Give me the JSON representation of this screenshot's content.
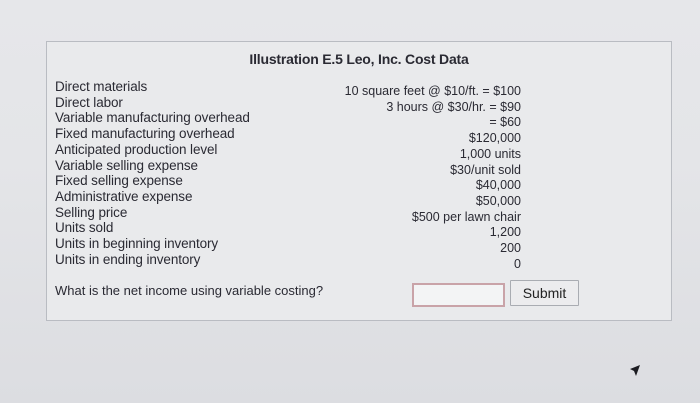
{
  "title": "Illustration E.5 Leo, Inc. Cost Data",
  "cost_data": [
    {
      "label": "Direct materials",
      "value": "10 square feet @ $10/ft. = $100"
    },
    {
      "label": "Direct labor",
      "value": "3 hours @ $30/hr. = $90"
    },
    {
      "label": "Variable manufacturing overhead",
      "value": "= $60"
    },
    {
      "label": "Fixed manufacturing overhead",
      "value": "$120,000"
    },
    {
      "label": "Anticipated production level",
      "value": "1,000 units"
    },
    {
      "label": "Variable selling expense",
      "value": "$30/unit sold"
    },
    {
      "label": "Fixed selling expense",
      "value": "$40,000"
    },
    {
      "label": "Administrative expense",
      "value": "$50,000"
    },
    {
      "label": "Selling price",
      "value": "$500 per lawn chair"
    },
    {
      "label": "Units sold",
      "value": "1,200"
    },
    {
      "label": "Units in beginning inventory",
      "value": "200"
    },
    {
      "label": "Units in ending inventory",
      "value": "0"
    }
  ],
  "question": "What is the net income using variable costing?",
  "answer": {
    "value": "",
    "placeholder": ""
  },
  "submit_label": "Submit",
  "cursor_icon": "pointer-arrow-icon"
}
